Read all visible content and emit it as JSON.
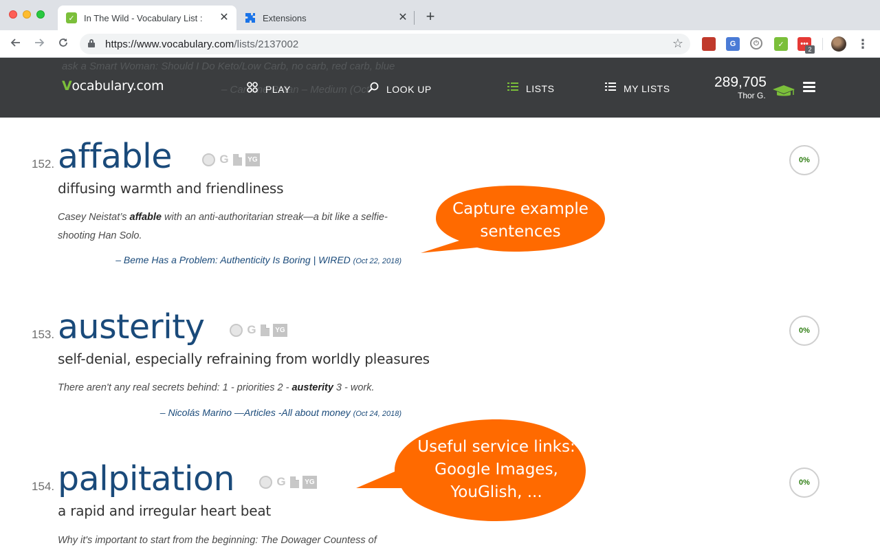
{
  "browser": {
    "tabs": [
      {
        "title": "In The Wild - Vocabulary List :",
        "icon": "vocabulary-check-icon",
        "active": true
      },
      {
        "title": "Extensions",
        "icon": "puzzle-icon",
        "active": false
      }
    ],
    "url_host": "https://www.vocabulary.com",
    "url_path": "/lists/2137002",
    "extension_badge": "2"
  },
  "site": {
    "logo_v": "V",
    "logo_rest": "ocabulary.com",
    "ghost_text_1": "ask a Smart Woman: Should I Do Keto/Low Carb, no carb, red carb, blue",
    "ghost_text_2": "– Caroline Ratan – Medium (Oct",
    "nav": [
      {
        "label": "PLAY",
        "icon": "grid-icon"
      },
      {
        "label": "LOOK UP",
        "icon": "search-icon"
      },
      {
        "label": "LISTS",
        "icon": "list-icon"
      },
      {
        "label": "MY LISTS",
        "icon": "list-icon"
      }
    ],
    "points": "289,705",
    "user": "Thor G.",
    "accent": "#7bbf3a"
  },
  "entries": [
    {
      "num": "152.",
      "word": "affable",
      "definition": "diffusing warmth and friendliness",
      "example_pre": "Casey Neistat’s ",
      "example_bold": "affable",
      "example_post": " with an anti-authoritarian streak—a bit like a selfie-shooting Han Solo.",
      "source": "– Beme Has a Problem: Authenticity Is Boring | WIRED",
      "date": "(Oct 22, 2018)",
      "progress": "0%"
    },
    {
      "num": "153.",
      "word": "austerity",
      "definition": "self-denial, especially refraining from worldly pleasures",
      "example_pre": "There aren't any real secrets behind: 1 - priorities 2 - ",
      "example_bold": "austerity",
      "example_post": " 3 - work.",
      "source": "– Nicolás Marino —Articles -All about money",
      "date": "(Oct 24, 2018)",
      "progress": "0%"
    },
    {
      "num": "154.",
      "word": "palpitation",
      "definition": "a rapid and irregular heart beat",
      "example_pre": "Why it's important to start from the beginning: The Dowager Countess of",
      "example_bold": "",
      "example_post": "",
      "progress": "0%"
    }
  ],
  "service_icons": [
    "duckduckgo-icon",
    "google-icon",
    "document-icon",
    "youglish-icon"
  ],
  "service_yg_label": "YG",
  "service_g_label": "G",
  "callouts": [
    {
      "line1": "Capture example",
      "line2": "sentences",
      "color": "#ff6a00"
    },
    {
      "line1": "Useful service links:",
      "line2": "Google Images,",
      "line3": "YouGlish, ...",
      "color": "#ff6a00"
    }
  ]
}
